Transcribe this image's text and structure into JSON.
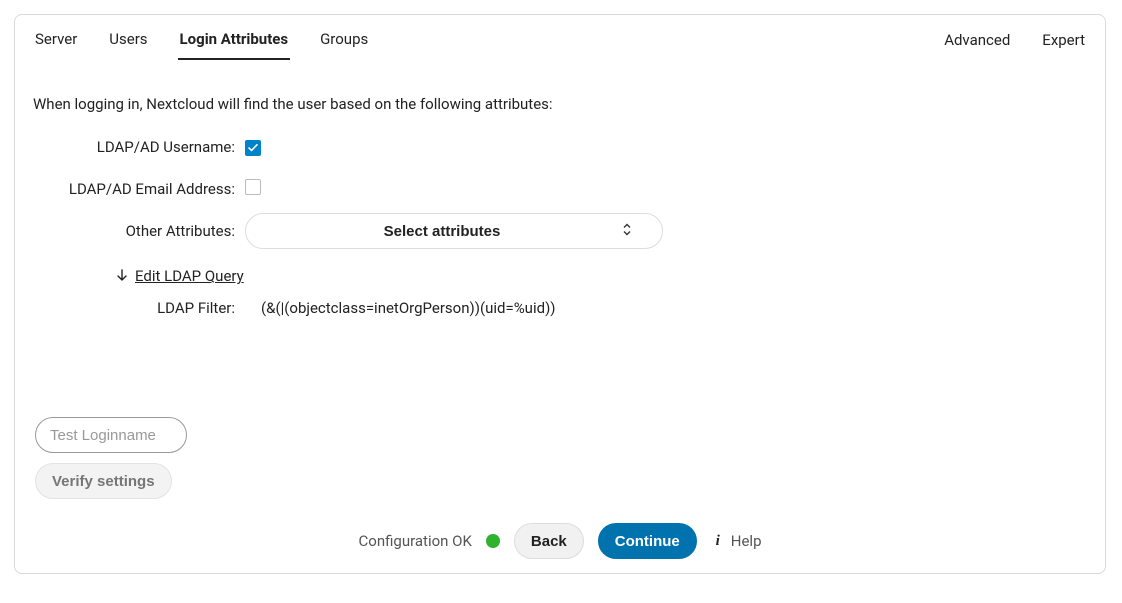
{
  "tabs_left": {
    "server": "Server",
    "users": "Users",
    "login_attrs": "Login Attributes",
    "groups": "Groups"
  },
  "tabs_right": {
    "advanced": "Advanced",
    "expert": "Expert"
  },
  "intro": "When logging in, Nextcloud will find the user based on the following attributes:",
  "fields": {
    "username_label": "LDAP/AD Username:",
    "username_checked": true,
    "email_label": "LDAP/AD Email Address:",
    "email_checked": false,
    "other_label": "Other Attributes:",
    "other_select_placeholder": "Select attributes",
    "edit_query_label": "Edit LDAP Query",
    "filter_label": "LDAP Filter:",
    "filter_value": "(&(|(objectclass=inetOrgPerson))(uid=%uid))"
  },
  "controls": {
    "test_login_placeholder": "Test Loginname",
    "verify_label": "Verify settings",
    "status_text": "Configuration OK",
    "status_color": "#2fb32f",
    "back_label": "Back",
    "continue_label": "Continue",
    "help_label": "Help"
  }
}
